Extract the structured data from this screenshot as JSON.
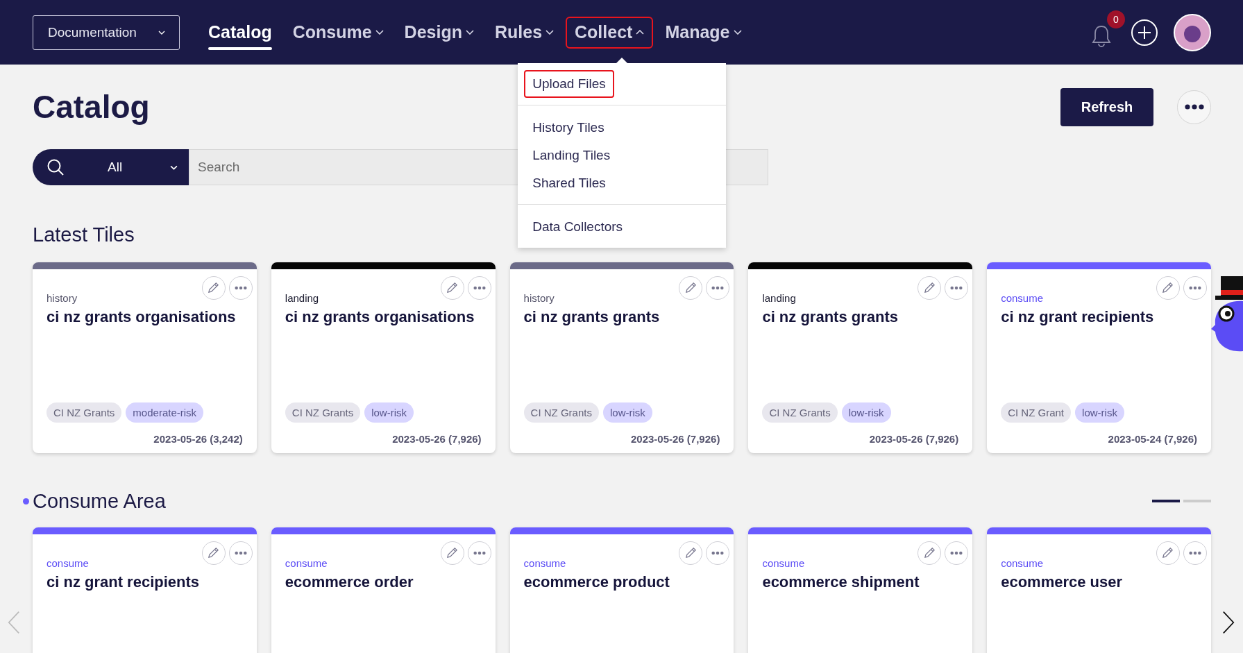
{
  "topbar": {
    "workspace": "Documentation",
    "nav": [
      {
        "label": "Catalog",
        "selected": true,
        "has_menu": false,
        "expanded": false,
        "highlighted": false
      },
      {
        "label": "Consume",
        "selected": false,
        "has_menu": true,
        "expanded": false,
        "highlighted": false
      },
      {
        "label": "Design",
        "selected": false,
        "has_menu": true,
        "expanded": false,
        "highlighted": false
      },
      {
        "label": "Rules",
        "selected": false,
        "has_menu": true,
        "expanded": false,
        "highlighted": false
      },
      {
        "label": "Collect",
        "selected": false,
        "has_menu": true,
        "expanded": true,
        "highlighted": true
      },
      {
        "label": "Manage",
        "selected": false,
        "has_menu": true,
        "expanded": false,
        "highlighted": false
      }
    ],
    "notification_count": "0"
  },
  "collect_menu": {
    "groups": [
      [
        {
          "label": "Upload Files",
          "highlighted": true
        }
      ],
      [
        {
          "label": "History Tiles",
          "highlighted": false
        },
        {
          "label": "Landing Tiles",
          "highlighted": false
        },
        {
          "label": "Shared Tiles",
          "highlighted": false
        }
      ],
      [
        {
          "label": "Data Collectors",
          "highlighted": false
        }
      ]
    ]
  },
  "page": {
    "title": "Catalog",
    "refresh_button": "Refresh"
  },
  "search": {
    "scope": "All",
    "placeholder": "Search"
  },
  "latest_tiles": {
    "title": "Latest Tiles",
    "tiles": [
      {
        "kind": "history",
        "type_label": "history",
        "name": "ci nz grants organisations",
        "tags": [
          {
            "label": "CI NZ Grants",
            "kind": "domain"
          },
          {
            "label": "moderate-risk",
            "kind": "risk"
          }
        ],
        "footer": "2023-05-26 (3,242)"
      },
      {
        "kind": "landing",
        "type_label": "landing",
        "name": "ci nz grants organisations",
        "tags": [
          {
            "label": "CI NZ Grants",
            "kind": "domain"
          },
          {
            "label": "low-risk",
            "kind": "risk"
          }
        ],
        "footer": "2023-05-26 (7,926)"
      },
      {
        "kind": "history",
        "type_label": "history",
        "name": "ci nz grants grants",
        "tags": [
          {
            "label": "CI NZ Grants",
            "kind": "domain"
          },
          {
            "label": "low-risk",
            "kind": "risk"
          }
        ],
        "footer": "2023-05-26 (7,926)"
      },
      {
        "kind": "landing",
        "type_label": "landing",
        "name": "ci nz grants grants",
        "tags": [
          {
            "label": "CI NZ Grants",
            "kind": "domain"
          },
          {
            "label": "low-risk",
            "kind": "risk"
          }
        ],
        "footer": "2023-05-26 (7,926)"
      },
      {
        "kind": "consume",
        "type_label": "consume",
        "name": "ci nz grant recipients",
        "tags": [
          {
            "label": "CI NZ Grant",
            "kind": "domain"
          },
          {
            "label": "low-risk",
            "kind": "risk"
          }
        ],
        "footer": "2023-05-24 (7,926)"
      }
    ]
  },
  "consume_area": {
    "title": "Consume Area",
    "pages": [
      {
        "selected": true
      },
      {
        "selected": false
      }
    ],
    "tiles": [
      {
        "kind": "consume",
        "type_label": "consume",
        "name": "ci nz grant recipients"
      },
      {
        "kind": "consume",
        "type_label": "consume",
        "name": "ecommerce order"
      },
      {
        "kind": "consume",
        "type_label": "consume",
        "name": "ecommerce product"
      },
      {
        "kind": "consume",
        "type_label": "consume",
        "name": "ecommerce shipment"
      },
      {
        "kind": "consume",
        "type_label": "consume",
        "name": "ecommerce user"
      }
    ]
  }
}
